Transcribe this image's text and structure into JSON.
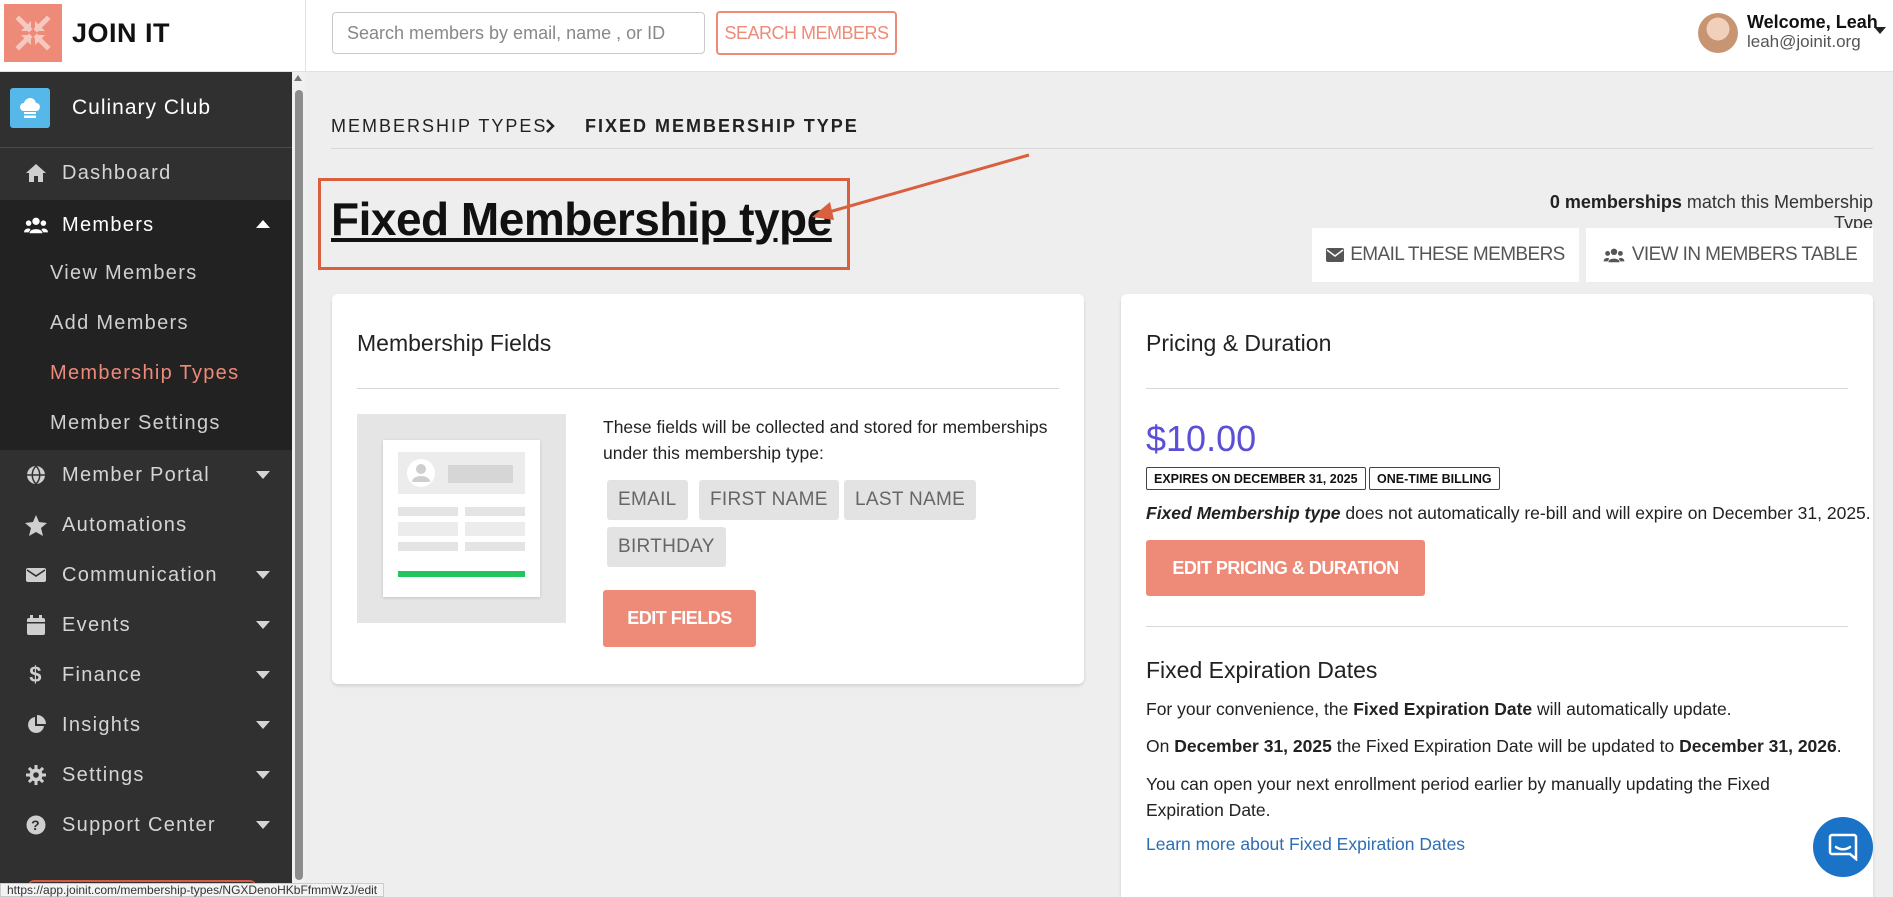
{
  "app": {
    "name": "JOIN IT"
  },
  "search": {
    "placeholder": "Search members by email, name , or ID",
    "button_label": "SEARCH MEMBERS"
  },
  "user": {
    "welcome": "Welcome, Leah",
    "email": "leah@joinit.org"
  },
  "sidebar": {
    "club_name": "Culinary Club",
    "items": [
      {
        "label": "Dashboard",
        "icon": "home-icon"
      },
      {
        "label": "Members",
        "icon": "users-icon",
        "expanded": true
      },
      {
        "label": "Member Portal",
        "icon": "globe-icon"
      },
      {
        "label": "Automations",
        "icon": "star-icon"
      },
      {
        "label": "Communication",
        "icon": "envelope-icon"
      },
      {
        "label": "Events",
        "icon": "calendar-icon"
      },
      {
        "label": "Finance",
        "icon": "dollar-icon"
      },
      {
        "label": "Insights",
        "icon": "pie-chart-icon"
      },
      {
        "label": "Settings",
        "icon": "gear-icon"
      },
      {
        "label": "Support Center",
        "icon": "question-icon"
      }
    ],
    "members_submenu": [
      {
        "label": "View Members"
      },
      {
        "label": "Add Members"
      },
      {
        "label": "Membership Types",
        "active": true
      },
      {
        "label": "Member Settings"
      }
    ]
  },
  "breadcrumb": {
    "parent": "MEMBERSHIP TYPES",
    "current": "FIXED MEMBERSHIP TYPE"
  },
  "page": {
    "title": "Fixed Membership type",
    "match_count": "0 memberships",
    "match_suffix": " match this Membership Type",
    "email_button": "EMAIL THESE MEMBERS",
    "view_table_button": "VIEW IN MEMBERS TABLE"
  },
  "fields_card": {
    "title": "Membership Fields",
    "description": "These fields will be collected and stored for memberships under this membership type:",
    "fields": [
      "EMAIL",
      "FIRST NAME",
      "LAST NAME",
      "BIRTHDAY"
    ],
    "edit_button": "EDIT FIELDS"
  },
  "pricing_card": {
    "title": "Pricing & Duration",
    "price": "$10.00",
    "tags": [
      "EXPIRES ON DECEMBER 31, 2025",
      "ONE-TIME BILLING"
    ],
    "note_name": "Fixed Membership type",
    "note_text": " does not automatically re-bill and will expire on December 31, 2025.",
    "edit_button": "EDIT PRICING & DURATION",
    "expiration_title": "Fixed Expiration Dates",
    "p1_a": "For your convenience, the ",
    "p1_b": "Fixed Expiration Date",
    "p1_c": " will automatically update.",
    "p2_a": "On ",
    "p2_b": "December 31, 2025",
    "p2_c": " the Fixed Expiration Date will be updated to ",
    "p2_d": "December 31, 2026",
    "p2_e": ".",
    "p3": "You can open your next enrollment period earlier by manually updating the Fixed Expiration Date.",
    "learn_link": "Learn more about Fixed Expiration Dates"
  },
  "status_bar": {
    "url": "https://app.joinit.com/membership-types/NGXDenoHKbFfmmWzJ/edit"
  },
  "colors": {
    "accent": "#ee8a78",
    "sidebar": "#303030",
    "price": "#5a4fd6",
    "link": "#2d6db5",
    "annotation": "#d9603f"
  }
}
